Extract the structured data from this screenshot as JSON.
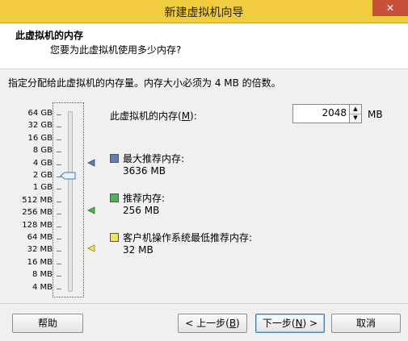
{
  "window": {
    "title": "新建虚拟机向导"
  },
  "header": {
    "title": "此虚拟机的内存",
    "subtitle": "您要为此虚拟机使用多少内存?"
  },
  "description": "指定分配给此虚拟机的内存量。内存大小必须为 4 MB 的倍数。",
  "scale": {
    "labels": [
      "64 GB",
      "32 GB",
      "16 GB",
      "8 GB",
      "4 GB",
      "2 GB",
      "1 GB",
      "512 MB",
      "256 MB",
      "128 MB",
      "64 MB",
      "32 MB",
      "16 MB",
      "8 MB",
      "4 MB"
    ],
    "selected": "2 GB"
  },
  "memory": {
    "label_prefix": "此虚拟机的内存(",
    "label_hotkey": "M",
    "label_suffix": "):",
    "value": "2048",
    "unit": "MB"
  },
  "recommendations": [
    {
      "title": "最大推荐内存:",
      "value": "3636 MB",
      "color": "#5f7fb8"
    },
    {
      "title": "推荐内存:",
      "value": "256 MB",
      "color": "#4cb848"
    },
    {
      "title": "客户机操作系统最低推荐内存:",
      "value": "32 MB",
      "color": "#f0e65a"
    }
  ],
  "buttons": {
    "help": "帮助",
    "back_prefix": "< 上一步(",
    "back_hotkey": "B",
    "back_suffix": ")",
    "next_prefix": "下一步(",
    "next_hotkey": "N",
    "next_suffix": ") >",
    "cancel": "取消"
  },
  "colors": {
    "titlebar": "#f0cc3e",
    "close": "#c7503b"
  }
}
